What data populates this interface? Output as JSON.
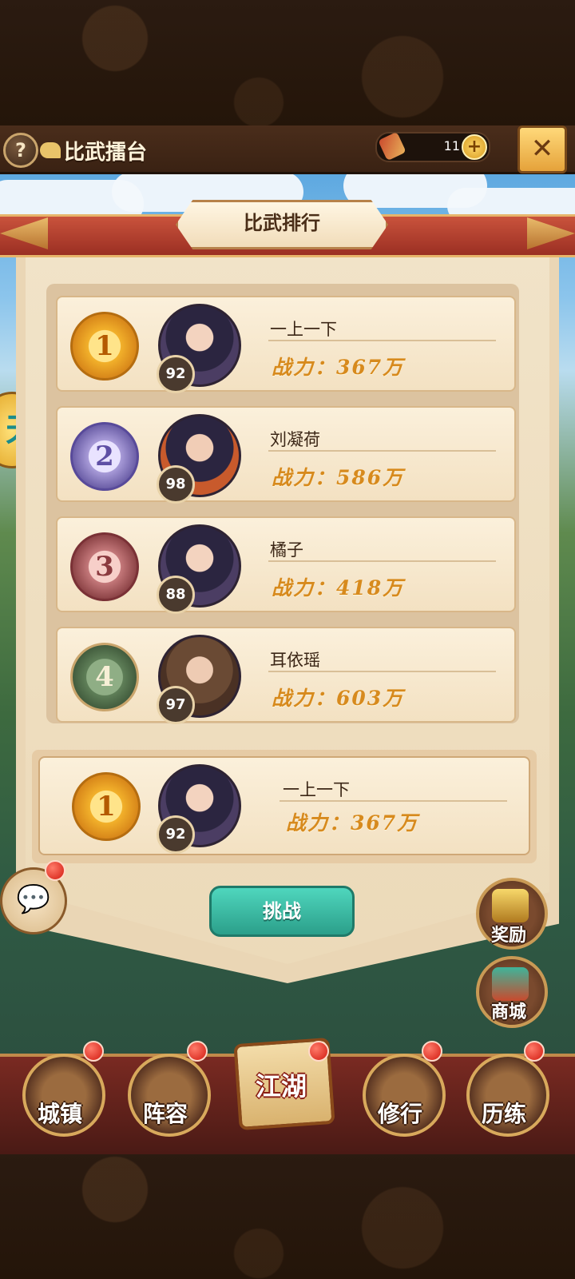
{
  "header": {
    "title": "比武擂台",
    "currency_count": "11",
    "help_symbol": "?",
    "plus_symbol": "+",
    "close_symbol": "✕"
  },
  "side_badge_text": "天",
  "panel": {
    "title": "比武排行"
  },
  "rankings": [
    {
      "rank": "1",
      "level": "92",
      "name": "一上一下",
      "power": "战力：367万",
      "medal": "gold"
    },
    {
      "rank": "2",
      "level": "98",
      "name": "刘凝荷",
      "power": "战力：586万",
      "medal": "silver"
    },
    {
      "rank": "3",
      "level": "88",
      "name": "橘子",
      "power": "战力：418万",
      "medal": "bronze"
    },
    {
      "rank": "4",
      "level": "97",
      "name": "耳依瑶",
      "power": "战力：603万",
      "medal": "plain"
    }
  ],
  "my_rank": {
    "rank": "1",
    "level": "92",
    "name": "一上一下",
    "power": "战力：367万"
  },
  "challenge_label": "挑战",
  "side_buttons": {
    "rewards": "奖励",
    "shop": "商城"
  },
  "nav": {
    "town": "城镇",
    "lineup": "阵容",
    "jianghu": "江湖",
    "practice": "修行",
    "trial": "历练"
  },
  "colors": {
    "power_text": "#d78a1d",
    "challenge_button": "#2b9f8a",
    "banner": "#9b2f23"
  }
}
